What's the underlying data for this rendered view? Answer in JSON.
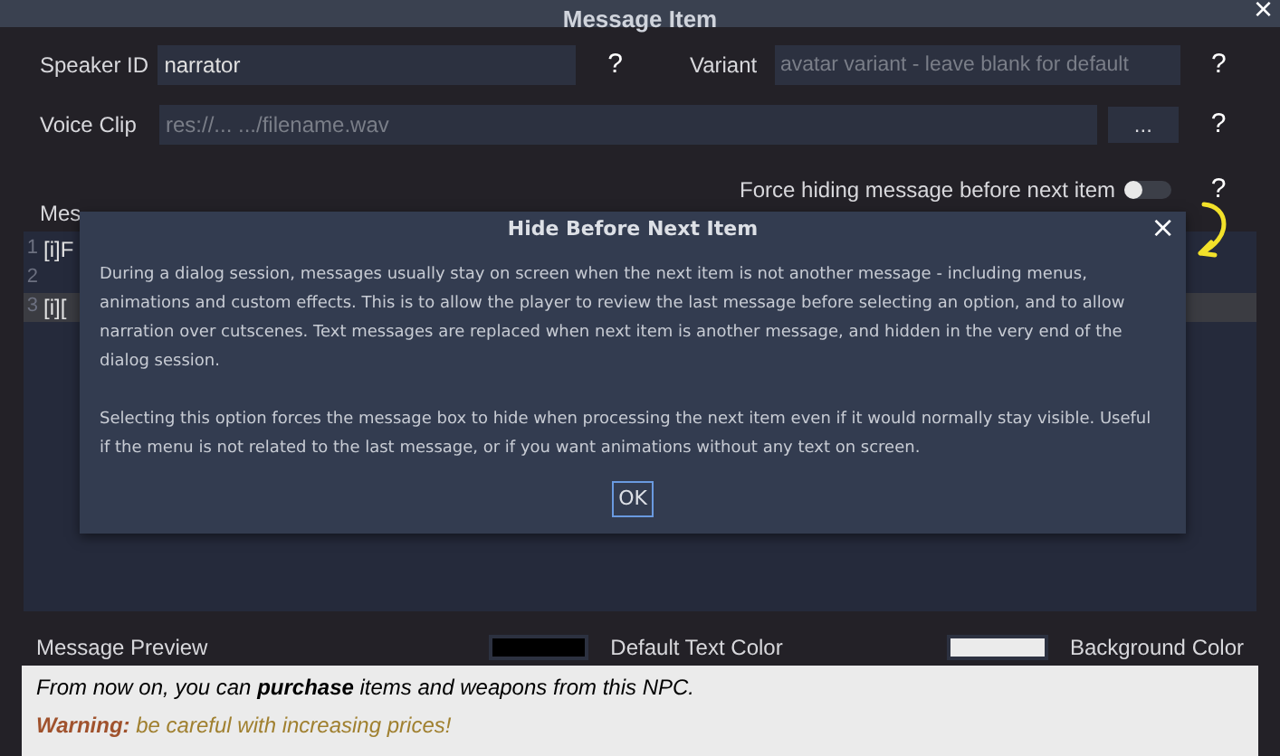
{
  "window": {
    "title": "Message Item",
    "close": "×"
  },
  "speaker": {
    "label": "Speaker ID",
    "value": "narrator",
    "help": "?"
  },
  "variant": {
    "label": "Variant",
    "placeholder": "avatar variant - leave blank for default",
    "help": "?"
  },
  "voice_clip": {
    "label": "Voice Clip",
    "placeholder": "res://... .../filename.wav",
    "browse": "...",
    "help": "?"
  },
  "force_hiding": {
    "label": "Force hiding message before next item",
    "on": false,
    "help": "?"
  },
  "message": {
    "label": "Mes",
    "lines": [
      {
        "number": "1",
        "text": "[i]F",
        "selected": false
      },
      {
        "number": "2",
        "selected": false
      },
      {
        "number": "3",
        "text": "[i][",
        "selected": true
      }
    ]
  },
  "dialog": {
    "title": "Hide Before Next Item",
    "close": "×",
    "paragraphs": [
      "During a dialog session, messages usually stay on screen when the next item is not another message - including menus, animations and custom effects. This is to allow the player to review the last message before selecting an option, and to allow narration over cutscenes. Text messages are replaced when next item is another message, and hidden in the very end of the dialog session.",
      "Selecting this option forces the message box to hide when processing the next item even if it would normally stay visible. Useful if the menu is not related to the last message, or if you want animations without any text on screen."
    ],
    "ok": "OK"
  },
  "preview": {
    "label": "Message Preview",
    "text_color": {
      "label": "Default Text Color",
      "color": "#000000"
    },
    "background_color": {
      "label": "Background Color",
      "color": "#ebebeb"
    },
    "lines": [
      {
        "segments": [
          {
            "text": "From now on, you can **purchase** items and weapons from this NPC.",
            "color": "#000000"
          }
        ]
      },
      {
        "segments": [
          {
            "text": "**Warning:**",
            "color": "#a0522d"
          },
          {
            "text": " be careful with increasing prices!",
            "color": "#a08030"
          }
        ]
      }
    ]
  }
}
